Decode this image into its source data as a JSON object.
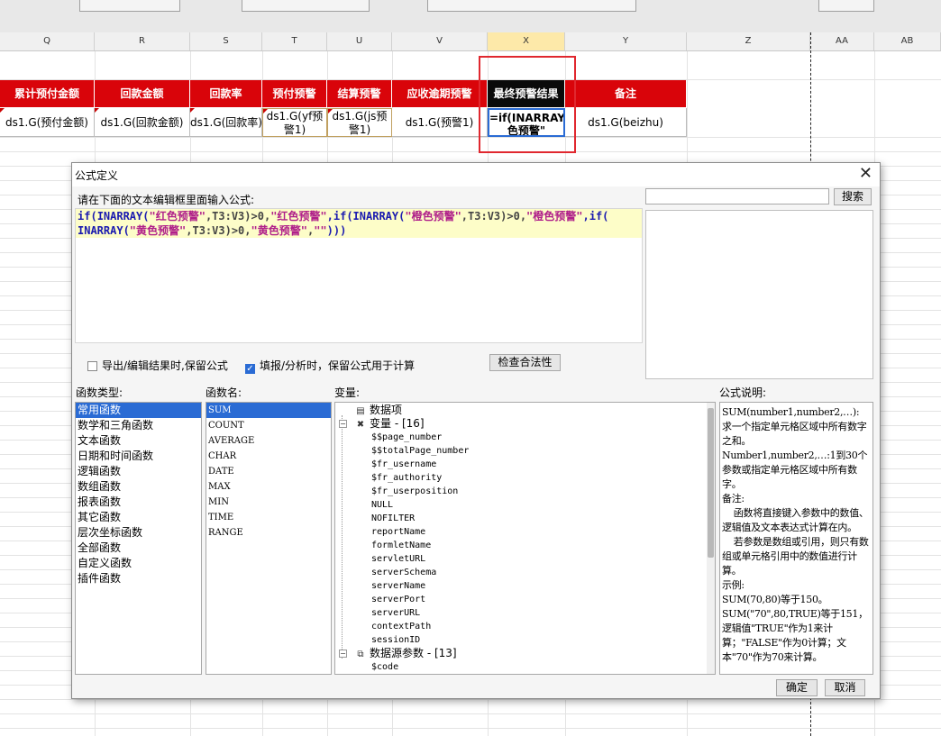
{
  "sheet": {
    "columns": [
      "Q",
      "R",
      "S",
      "T",
      "U",
      "V",
      "X",
      "Y",
      "Z",
      "AA",
      "AB"
    ],
    "selected_column": "X",
    "headers": [
      "累计预付金额",
      "回款金额",
      "回款率",
      "预付预警",
      "结算预警",
      "应收逾期预警",
      "最终预警结果",
      "备注"
    ],
    "cells": [
      "ds1.G(预付金额)",
      "ds1.G(回款金额)",
      "ds1.G(回款率)",
      "ds1.G(yf预警1)",
      "ds1.G(js预警1)",
      "ds1.G(预警1)",
      "=if(INARRAY(\"红色预警\"",
      "ds1.G(beizhu)"
    ],
    "colors": {
      "header_red": "#d9040a",
      "header_black": "#0a0a0a",
      "highlight_box": "#e0282f"
    }
  },
  "dialog": {
    "title": "公式定义",
    "close_glyph": "✕",
    "prompt": "请在下面的文本编辑框里面输入公式:",
    "formula": {
      "line1": [
        "if(",
        "INARRAY(",
        "\"红色预警\"",
        ",T3:V3)>0,",
        "\"红色预警\"",
        ",if(",
        "INARRAY(",
        "\"橙色预警\"",
        ",T3:V3)>0,",
        "\"橙色预警\"",
        ",if("
      ],
      "line2": [
        "INARRAY(",
        "\"黄色预警\"",
        ",T3:V3)>0,",
        "\"黄色预警\"",
        ",",
        "\"\"",
        ")))"
      ]
    },
    "search_button": "搜索",
    "checkbox_export": {
      "label": "导出/编辑结果时,保留公式",
      "checked": false
    },
    "checkbox_fill": {
      "label": "填报/分析时，保留公式用于计算",
      "checked": true
    },
    "validate_button": "检查合法性",
    "labels": {
      "func_type": "函数类型:",
      "func_name": "函数名:",
      "variables": "变量:",
      "description": "公式说明:"
    },
    "func_types": [
      "常用函数",
      "数学和三角函数",
      "文本函数",
      "日期和时间函数",
      "逻辑函数",
      "数组函数",
      "报表函数",
      "其它函数",
      "层次坐标函数",
      "全部函数",
      "自定义函数",
      "插件函数"
    ],
    "func_names": [
      "SUM",
      "COUNT",
      "AVERAGE",
      "CHAR",
      "DATE",
      "MAX",
      "MIN",
      "TIME",
      "RANGE"
    ],
    "variables": {
      "data_item": "数据项",
      "var_group": "变量 - [16]",
      "vars": [
        "$$page_number",
        "$$totalPage_number",
        "$fr_username",
        "$fr_authority",
        "$fr_userposition",
        "NULL",
        "NOFILTER",
        "reportName",
        "formletName",
        "servletURL",
        "serverSchema",
        "serverName",
        "serverPort",
        "serverURL",
        "contextPath",
        "sessionID"
      ],
      "ds_group": "数据源参数 - [13]",
      "ds_vars": [
        "$code"
      ]
    },
    "description_text": "SUM(number1,number2,…): 求一个指定单元格区域中所有数字之和。\nNumber1,number2,…:1到30个参数或指定单元格区域中所有数字。\n备注:\n    函数将直接键入参数中的数值、逻辑值及文本表达式计算在内。\n    若参数是数组或引用，则只有数组或单元格引用中的数值进行计算。\n示例:\nSUM(70,80)等于150。\nSUM(\"70\",80,TRUE)等于151，逻辑值\"TRUE\"作为1来计算；\"FALSE\"作为0计算；文本\"70\"作为70来计算。",
    "ok_button": "确定",
    "cancel_button": "取消"
  }
}
